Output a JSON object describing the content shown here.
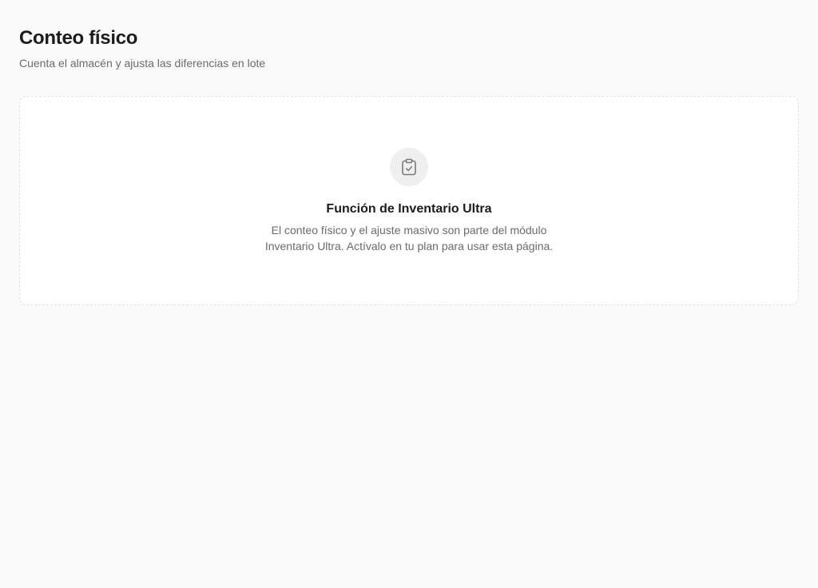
{
  "header": {
    "title": "Conteo físico",
    "subtitle": "Cuenta el almacén y ajusta las diferencias en lote"
  },
  "empty_state": {
    "icon": "clipboard-check-icon",
    "title": "Función de Inventario Ultra",
    "description": "El conteo físico y el ajuste masivo son parte del módulo Inventario Ultra. Actívalo en tu plan para usar esta página."
  },
  "colors": {
    "background": "#fafafa",
    "card": "#ffffff",
    "icon_bg": "#efefef",
    "text_primary": "#1c1c1e",
    "text_secondary": "#6b6b6f"
  }
}
